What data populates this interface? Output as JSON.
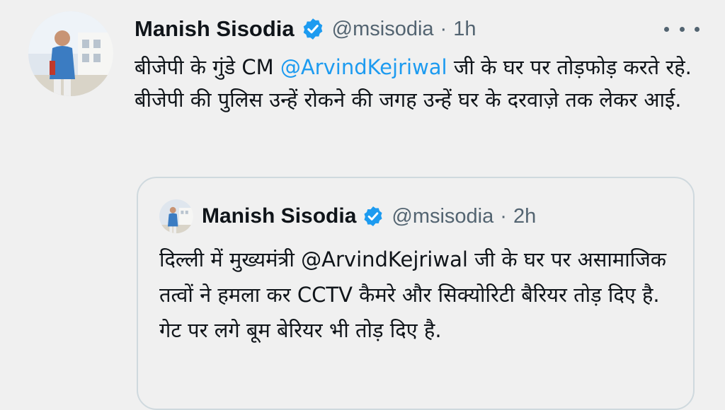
{
  "tweet": {
    "author_name": "Manish Sisodia",
    "handle": "@msisodia",
    "separator": "·",
    "time": "1h",
    "text_part1": "बीजेपी के गुंडे CM ",
    "mention": "@ArvindKejriwal",
    "text_part2": " जी के घर पर तोड़फोड़ करते रहे. बीजेपी की पुलिस उन्हें रोकने की जगह उन्हें घर के दरवाज़े तक लेकर आई."
  },
  "quoted_tweet": {
    "author_name": "Manish Sisodia",
    "handle": "@msisodia",
    "separator": "·",
    "time": "2h",
    "text": "दिल्ली में मुख्यमंत्री @ArvindKejriwal जी के घर पर असामाजिक तत्वों ने हमला कर CCTV कैमरे और सिक्योरिटी बैरियर तोड़ दिए है. गेट पर लगे बूम बेरियर भी तोड़ दिए है."
  },
  "icons": {
    "verified": "verified-badge-icon",
    "more": "more-options-icon"
  },
  "colors": {
    "background": "#f0f0f0",
    "text": "#0f1419",
    "secondary": "#536471",
    "link": "#1d9bf0",
    "border": "#cfd9de"
  }
}
